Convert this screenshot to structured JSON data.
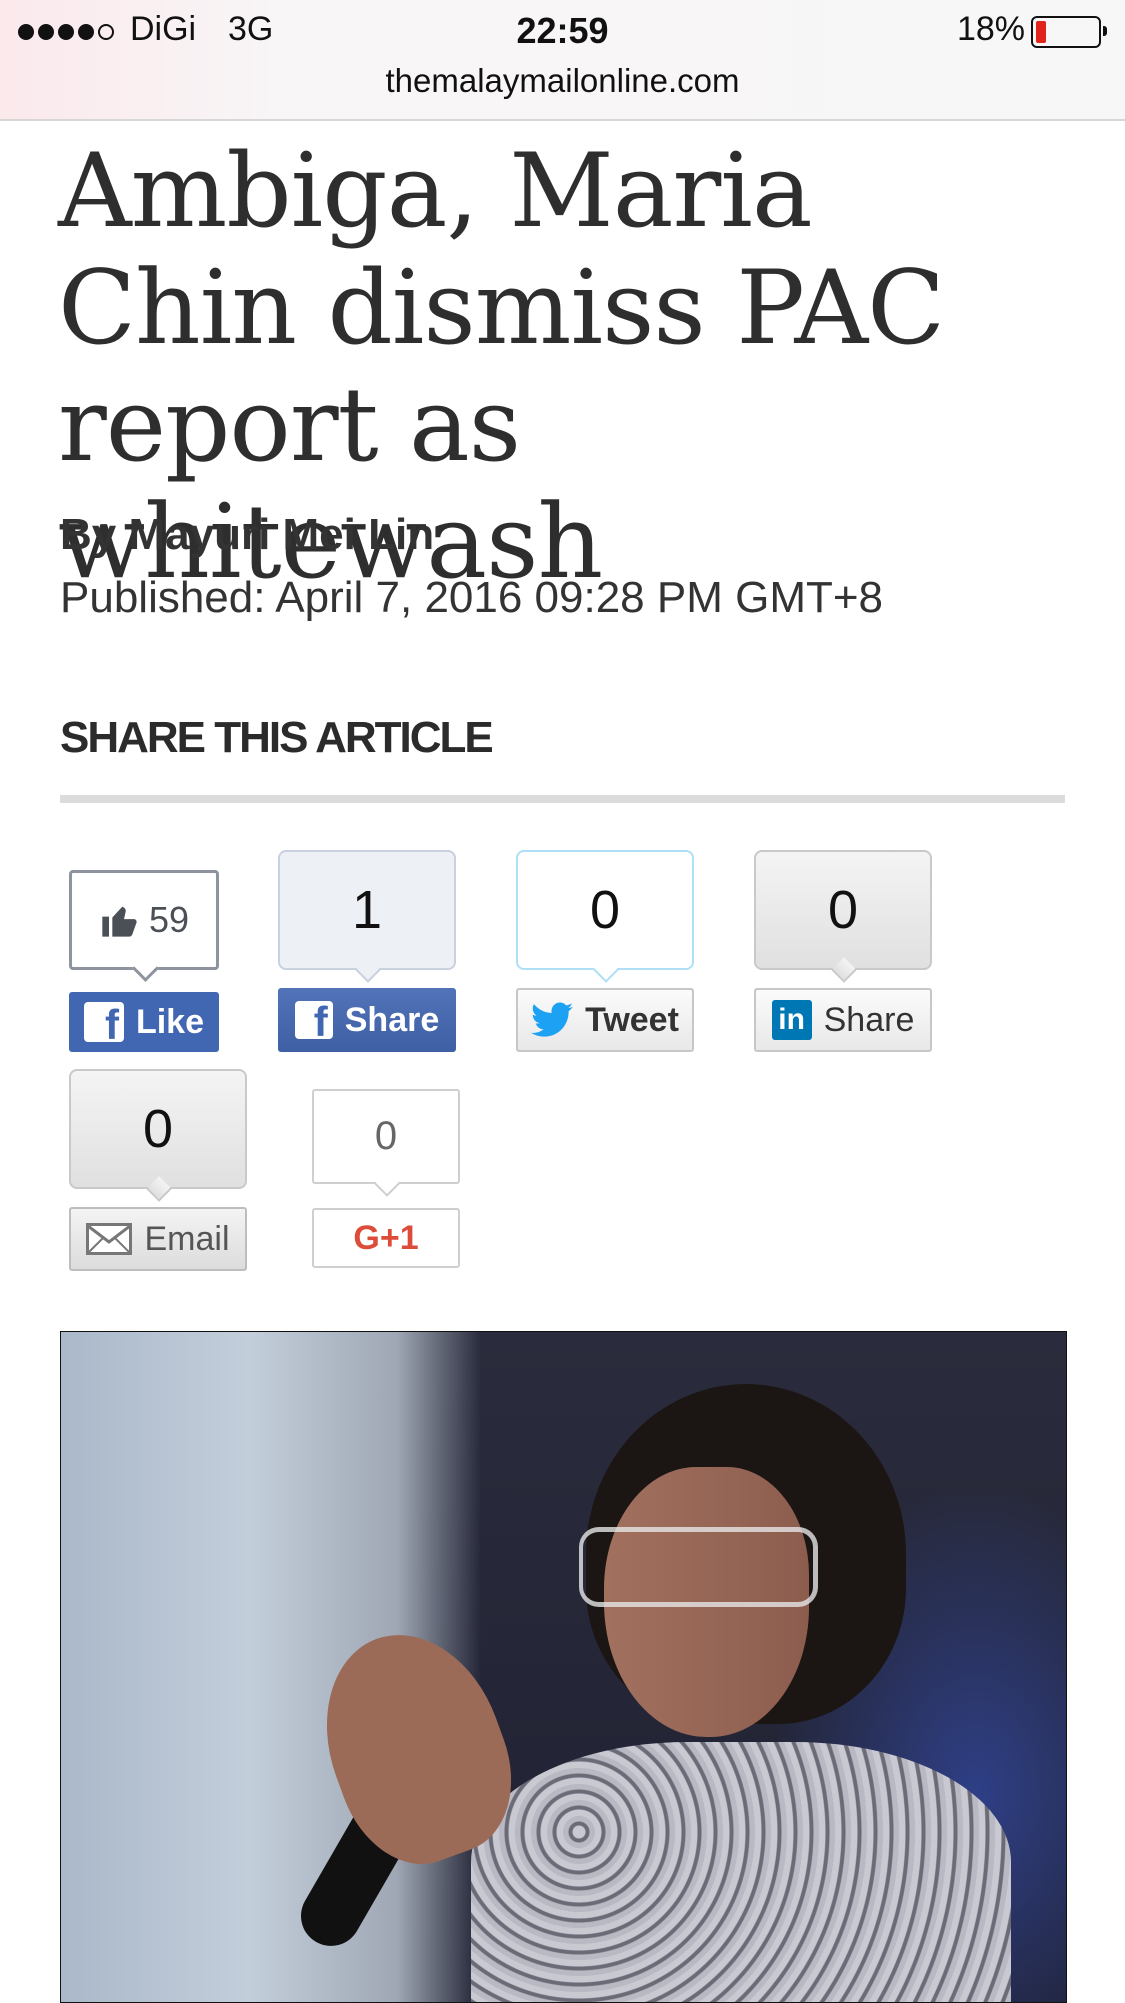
{
  "status_bar": {
    "carrier": "DiGi",
    "network": "3G",
    "time": "22:59",
    "battery_percent": "18%",
    "battery_level": 0.18,
    "signal_bars_filled": 4,
    "signal_bars_total": 5
  },
  "address_bar": {
    "domain": "themalaymailonline.com"
  },
  "article": {
    "headline": "Ambiga, Maria Chin dismiss PAC report as whitewash",
    "byline": "By Mayuri Mei Lin",
    "published": "Published: April 7, 2016 09:28 PM GMT+8"
  },
  "share": {
    "title": "SHARE THIS ARTICLE",
    "facebook_like": {
      "count": "59",
      "label": "Like",
      "color": "#4267b2"
    },
    "facebook_share": {
      "count": "1",
      "label": "Share",
      "color": "#4267b2"
    },
    "twitter": {
      "count": "0",
      "label": "Tweet",
      "color": "#1da1f2"
    },
    "linkedin": {
      "count": "0",
      "label": "Share",
      "icon_text": "in",
      "color": "#0077b5"
    },
    "email": {
      "count": "0",
      "label": "Email"
    },
    "google_plus": {
      "count": "0",
      "label": "G+1",
      "color": "#dd4b39"
    }
  },
  "icons": [
    "thumbs-up-icon",
    "facebook-icon",
    "twitter-bird-icon",
    "linkedin-icon",
    "envelope-icon"
  ]
}
